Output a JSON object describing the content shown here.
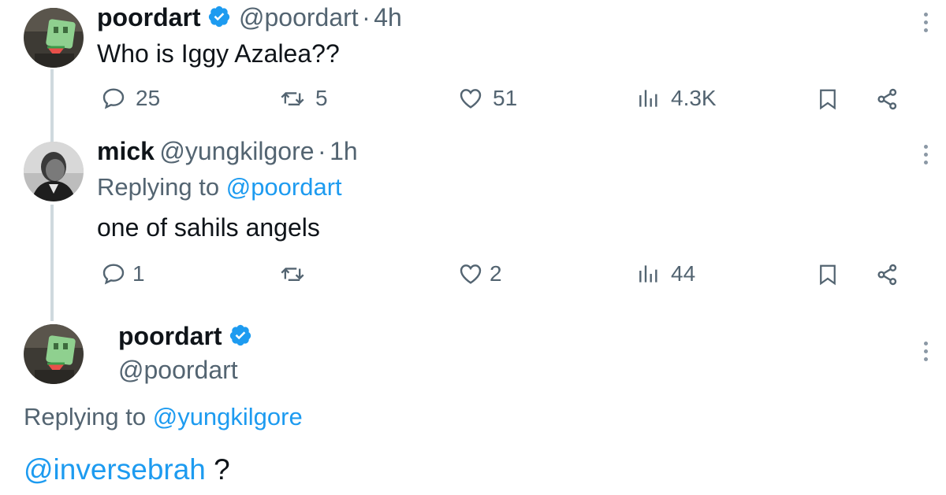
{
  "tweet1": {
    "name": "poordart",
    "handle": "@poordart",
    "sep": "·",
    "time": "4h",
    "text": "Who is Iggy Azalea??",
    "replies": "25",
    "retweets": "5",
    "likes": "51",
    "views": "4.3K"
  },
  "tweet2": {
    "name": "mick",
    "handle": "@yungkilgore",
    "sep": "·",
    "time": "1h",
    "replying_prefix": "Replying to",
    "replying_to": "@poordart",
    "text": "one of sahils angels",
    "replies": "1",
    "retweets": "",
    "likes": "2",
    "views": "44"
  },
  "tweet3": {
    "name": "poordart",
    "handle": "@poordart",
    "replying_prefix": "Replying to",
    "replying_to": "@yungkilgore",
    "mention": "@inversebrah",
    "text_suffix": "?"
  },
  "colors": {
    "accent": "#1d9bf0",
    "secondary_text": "#536471",
    "primary_text": "#0f1419",
    "thread_line": "#cfd9de"
  },
  "icons": [
    "verified-badge-icon",
    "reply-icon",
    "retweet-icon",
    "like-icon",
    "views-icon",
    "bookmark-icon",
    "share-icon",
    "more-icon"
  ]
}
